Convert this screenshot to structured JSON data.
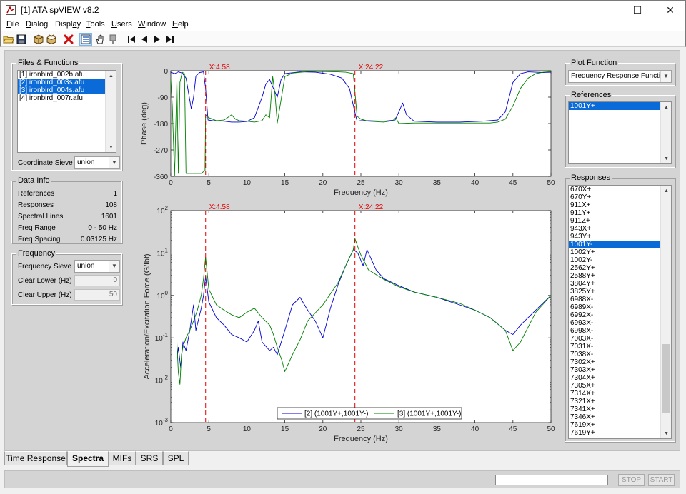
{
  "window": {
    "title": "[1] ATA spVIEW v8.2",
    "minimize": "—",
    "maximize": "☐",
    "close": "✕"
  },
  "menu": [
    {
      "key": "F",
      "rest": "ile"
    },
    {
      "key": "D",
      "rest": "ialog"
    },
    {
      "key": "",
      "rest": "Displ",
      "key2": "a",
      "rest2": "y"
    },
    {
      "key": "T",
      "rest": "ools"
    },
    {
      "key": "U",
      "rest": "sers"
    },
    {
      "key": "W",
      "rest": "indow"
    },
    {
      "key": "H",
      "rest": "elp"
    }
  ],
  "files_panel": {
    "title": "Files & Functions",
    "files": [
      {
        "label": "[1] ironbird_002b.afu",
        "selected": false
      },
      {
        "label": "[2] ironbird_003s.afu",
        "selected": true
      },
      {
        "label": "[3] ironbird_004s.afu",
        "selected": true
      },
      {
        "label": "[4] ironbird_007r.afu",
        "selected": false
      }
    ],
    "coordinate_sieve_label": "Coordinate Sieve",
    "coordinate_sieve_value": "union"
  },
  "data_info": {
    "title": "Data Info",
    "rows": [
      {
        "label": "References",
        "value": "1"
      },
      {
        "label": "Responses",
        "value": "108"
      },
      {
        "label": "Spectral Lines",
        "value": "1601"
      },
      {
        "label": "Freq Range",
        "value": "0 - 50 Hz"
      },
      {
        "label": "Freq Spacing",
        "value": "0.03125 Hz"
      }
    ]
  },
  "frequency": {
    "title": "Frequency",
    "sieve_label": "Frequency Sieve",
    "sieve_value": "union",
    "clear_lower_label": "Clear Lower (Hz)",
    "clear_lower_value": "0",
    "clear_upper_label": "Clear Upper (Hz)",
    "clear_upper_value": "50"
  },
  "plot_function": {
    "title": "Plot Function",
    "value": "Frequency Response Function"
  },
  "references": {
    "title": "References",
    "items": [
      {
        "label": "1001Y+",
        "selected": true
      }
    ]
  },
  "responses": {
    "title": "Responses",
    "items": [
      "670X+",
      "670Y+",
      "911X+",
      "911Y+",
      "911Z+",
      "943X+",
      "943Y+",
      "1001Y-",
      "1002Y+",
      "1002Y-",
      "2562Y+",
      "2588Y+",
      "3804Y+",
      "3825Y+",
      "6988X-",
      "6989X-",
      "6992X-",
      "6993X-",
      "6998X-",
      "7003X-",
      "7031X-",
      "7038X-",
      "7302X+",
      "7303X+",
      "7304X+",
      "7305X+",
      "7314X+",
      "7321X+",
      "7341X+",
      "7346X+",
      "7619X+",
      "7619Y+"
    ],
    "selected": "1001Y-"
  },
  "tabs": [
    {
      "label": "Time Response",
      "active": false
    },
    {
      "label": "Spectra",
      "active": true
    },
    {
      "label": "MIFs",
      "active": false
    },
    {
      "label": "SRS",
      "active": false
    },
    {
      "label": "SPL",
      "active": false
    }
  ],
  "status": {
    "stop_label": "STOP",
    "start_label": "START"
  },
  "toolbar_icons": [
    "open-folder-icon",
    "save-icon",
    "box-icon",
    "box-open-icon",
    "delete-icon",
    "select-icon",
    "hand-icon",
    "pan-icon",
    "first-icon",
    "prev-icon",
    "next-icon",
    "last-icon"
  ],
  "colors": {
    "series1": "#0000d4",
    "series2": "#008000",
    "cursor": "#e00000",
    "selection": "#0a6ad8"
  },
  "chart_data": [
    {
      "type": "line",
      "ylabel": "Phase (deg)",
      "xlabel": "Frequency (Hz)",
      "xlim": [
        0,
        50
      ],
      "ylim": [
        -360,
        0
      ],
      "xticks": [
        "0",
        "5",
        "10",
        "15",
        "20",
        "25",
        "30",
        "35",
        "40",
        "45",
        "50"
      ],
      "yticks": [
        "0",
        "-90",
        "-180",
        "-270",
        "-360"
      ],
      "cursors": [
        {
          "x": 4.58,
          "label": "X:4.58"
        },
        {
          "x": 24.22,
          "label": "X:24.22"
        }
      ],
      "series": [
        {
          "name": "[2] (1001Y+,1001Y-)",
          "x": [
            0,
            0.5,
            1,
            1.5,
            2,
            2.4,
            2.7,
            3,
            3.3,
            3.8,
            4.3,
            4.58,
            4.9,
            5.5,
            7,
            8,
            9,
            10,
            11,
            12,
            12.5,
            13,
            13.5,
            14,
            14.5,
            15,
            17,
            19,
            21,
            22.5,
            23.5,
            24.2,
            24.5,
            25,
            26,
            28,
            29.5,
            30,
            30.5,
            31,
            32,
            35,
            38,
            41,
            43,
            44,
            45,
            46,
            47,
            48,
            49,
            50
          ],
          "y": [
            -5,
            -10,
            -4,
            -8,
            -25,
            -85,
            -130,
            -90,
            -18,
            -6,
            -4,
            -60,
            -168,
            -170,
            -172,
            -175,
            -175,
            -173,
            -160,
            -90,
            -45,
            -30,
            -60,
            -90,
            -30,
            -10,
            -4,
            -5,
            -12,
            -25,
            -60,
            -140,
            -172,
            -170,
            -170,
            -172,
            -168,
            -140,
            -110,
            -150,
            -172,
            -175,
            -175,
            -172,
            -168,
            -140,
            -40,
            -10,
            -4,
            -5,
            -6,
            -5
          ]
        },
        {
          "name": "[3] (1001Y+,1001Y-)",
          "x": [
            0,
            0.2,
            0.5,
            0.8,
            1,
            1.2,
            1.5,
            1.8,
            2,
            3,
            4,
            4.5,
            4.58,
            5,
            6,
            7,
            8,
            8.5,
            9,
            10,
            11,
            12,
            12.5,
            13,
            13.4,
            13.7,
            14,
            15,
            16,
            18,
            20,
            22,
            23,
            24,
            24.5,
            25,
            26,
            28,
            29.2,
            29.6,
            30,
            32,
            36,
            40,
            42,
            43,
            44,
            45,
            46,
            47,
            48,
            49,
            50
          ],
          "y": [
            -30,
            -120,
            -360,
            -30,
            -350,
            -40,
            -5,
            -10,
            -350,
            -350,
            -350,
            -340,
            -150,
            -160,
            -170,
            -168,
            -150,
            -165,
            -170,
            -172,
            -175,
            -170,
            -150,
            -160,
            -20,
            -80,
            -178,
            -20,
            -8,
            -3,
            -3,
            -4,
            -5,
            -10,
            -155,
            -165,
            -172,
            -175,
            -170,
            -160,
            -180,
            -178,
            -178,
            -178,
            -178,
            -175,
            -165,
            -120,
            -60,
            -25,
            -10,
            -5,
            -3
          ]
        }
      ]
    },
    {
      "type": "line",
      "ylabel": "Acceleration/Excitation Force (G/lbf)",
      "xlabel": "Frequency (Hz)",
      "xlim": [
        0,
        50
      ],
      "ylim": [
        0.001,
        100
      ],
      "yscale": "log",
      "xticks": [
        "0",
        "5",
        "10",
        "15",
        "20",
        "25",
        "30",
        "35",
        "40",
        "45",
        "50"
      ],
      "yticks": [
        "10^2",
        "10^1",
        "10^0",
        "10^-1",
        "10^-2",
        "10^-3"
      ],
      "cursors": [
        {
          "x": 4.58,
          "label": "X:4.58"
        },
        {
          "x": 24.22,
          "label": "X:24.22"
        }
      ],
      "legend": "bottom-center",
      "series": [
        {
          "name": "[2] (1001Y+,1001Y-)",
          "x": [
            0.8,
            1,
            1.3,
            1.6,
            2,
            2.5,
            3,
            3.3,
            3.6,
            4,
            4.3,
            4.58,
            5,
            6,
            7,
            8,
            9,
            10,
            11,
            11.5,
            12,
            13,
            13.5,
            14,
            15,
            16,
            17,
            18,
            19,
            20,
            21,
            22,
            23,
            24,
            24.6,
            25.3,
            25.8,
            27,
            28,
            30,
            32,
            35,
            38,
            40,
            42,
            44,
            45,
            46,
            48,
            50
          ],
          "y": [
            0.03,
            0.06,
            0.02,
            0.08,
            0.05,
            0.15,
            0.6,
            0.15,
            0.25,
            0.5,
            1,
            2.8,
            0.7,
            0.3,
            0.2,
            0.12,
            0.1,
            0.08,
            0.15,
            0.25,
            0.08,
            0.05,
            0.06,
            0.04,
            0.15,
            0.6,
            0.9,
            0.45,
            0.25,
            0.1,
            0.5,
            1.8,
            5,
            12,
            10,
            5,
            12,
            4,
            2.5,
            1.7,
            1.2,
            0.9,
            0.6,
            0.45,
            0.3,
            0.15,
            0.12,
            0.2,
            0.45,
            1
          ]
        },
        {
          "name": "[3] (1001Y+,1001Y-)",
          "x": [
            0.8,
            1,
            1.2,
            1.4,
            1.6,
            2,
            2.5,
            3,
            3.5,
            4,
            4.3,
            4.58,
            5,
            6,
            7,
            8,
            9,
            10,
            11,
            12,
            13,
            13.5,
            14,
            14.6,
            15,
            16,
            17,
            18,
            20,
            22,
            23,
            24,
            24.22,
            24.6,
            25,
            26,
            28,
            30,
            32,
            35,
            38,
            40,
            42,
            44,
            45,
            46,
            48,
            50
          ],
          "y": [
            0.08,
            0.015,
            0.008,
            0.04,
            0.06,
            0.1,
            0.15,
            0.25,
            0.45,
            1,
            2.5,
            8,
            1.4,
            0.6,
            0.45,
            0.35,
            0.3,
            0.4,
            0.5,
            0.3,
            0.2,
            0.12,
            0.06,
            0.03,
            0.016,
            0.04,
            0.09,
            0.25,
            0.6,
            2,
            5,
            12,
            22,
            14,
            9,
            4,
            2.4,
            1.6,
            1.2,
            0.9,
            0.65,
            0.45,
            0.3,
            0.15,
            0.05,
            0.08,
            0.4,
            1
          ]
        }
      ]
    }
  ]
}
